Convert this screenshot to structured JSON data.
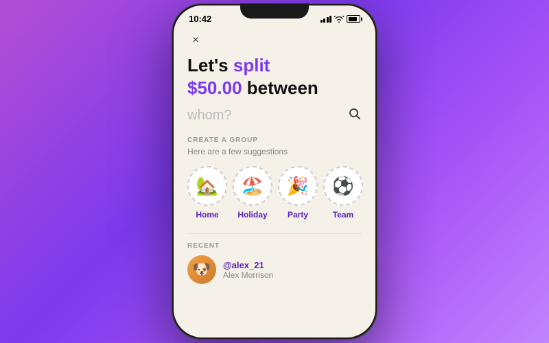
{
  "phone": {
    "status_bar": {
      "time": "10:42"
    },
    "screen": {
      "close_label": "×",
      "heading_line1_normal": "Let's ",
      "heading_line1_accent": "split",
      "heading_line2_amount": "$50.00",
      "heading_line2_normal": " between",
      "search_placeholder": "whom?",
      "create_group": {
        "section_label": "CREATE A GROUP",
        "subtitle": "Here are a few suggestions",
        "items": [
          {
            "id": "home",
            "emoji": "🏡",
            "label": "Home"
          },
          {
            "id": "holiday",
            "emoji": "🏖️",
            "label": "Holiday"
          },
          {
            "id": "party",
            "emoji": "🎉",
            "label": "Party"
          },
          {
            "id": "team",
            "emoji": "⚽",
            "label": "Team"
          }
        ]
      },
      "recent": {
        "section_label": "RECENT",
        "items": [
          {
            "handle": "@alex_21",
            "name": "Alex Morrison",
            "emoji": "🐶"
          }
        ]
      }
    }
  }
}
